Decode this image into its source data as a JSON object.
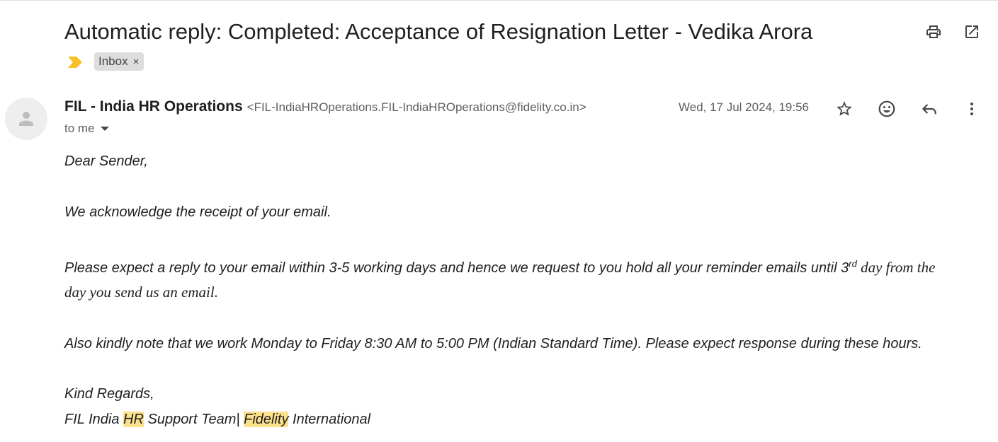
{
  "email": {
    "subject": "Automatic reply: Completed: Acceptance of Resignation Letter - Vedika Arora",
    "label": "Inbox",
    "label_remove": "×",
    "sender_name": "FIL - India HR Operations",
    "sender_email": "<FIL-IndiaHROperations.FIL-IndiaHROperations@fidelity.co.in>",
    "recipient_summary": "to me",
    "date": "Wed, 17 Jul 2024, 19:56"
  },
  "body": {
    "greeting": "Dear Sender,",
    "ack": "We acknowledge the receipt of your email.",
    "expect_part1": "Please expect a reply to your email within 3-5 working days and hence we request to you hold all your reminder emails until 3",
    "expect_sup": "rd",
    "expect_part2": " day from the",
    "expect_line2": "day you send us an email.",
    "hours": "Also kindly note that we work Monday to Friday 8:30 AM to 5:00 PM (Indian Standard Time). Please expect response during these hours.",
    "regards": "Kind Regards,",
    "sig_a": "FIL India ",
    "sig_hr": "HR",
    "sig_b": " Support Team| ",
    "sig_fidelity": "Fidelity",
    "sig_c": " International"
  },
  "icons": {
    "importance": "importance-marker-icon",
    "print": "print-icon",
    "open": "open-in-new-window-icon",
    "avatar": "person-icon",
    "star": "star-icon",
    "emoji": "emoji-reaction-icon",
    "reply": "reply-icon",
    "more": "more-vertical-icon"
  },
  "colors": {
    "importance": "#f6c026",
    "highlight": "#fce18d",
    "chip_bg": "#dddddd"
  }
}
